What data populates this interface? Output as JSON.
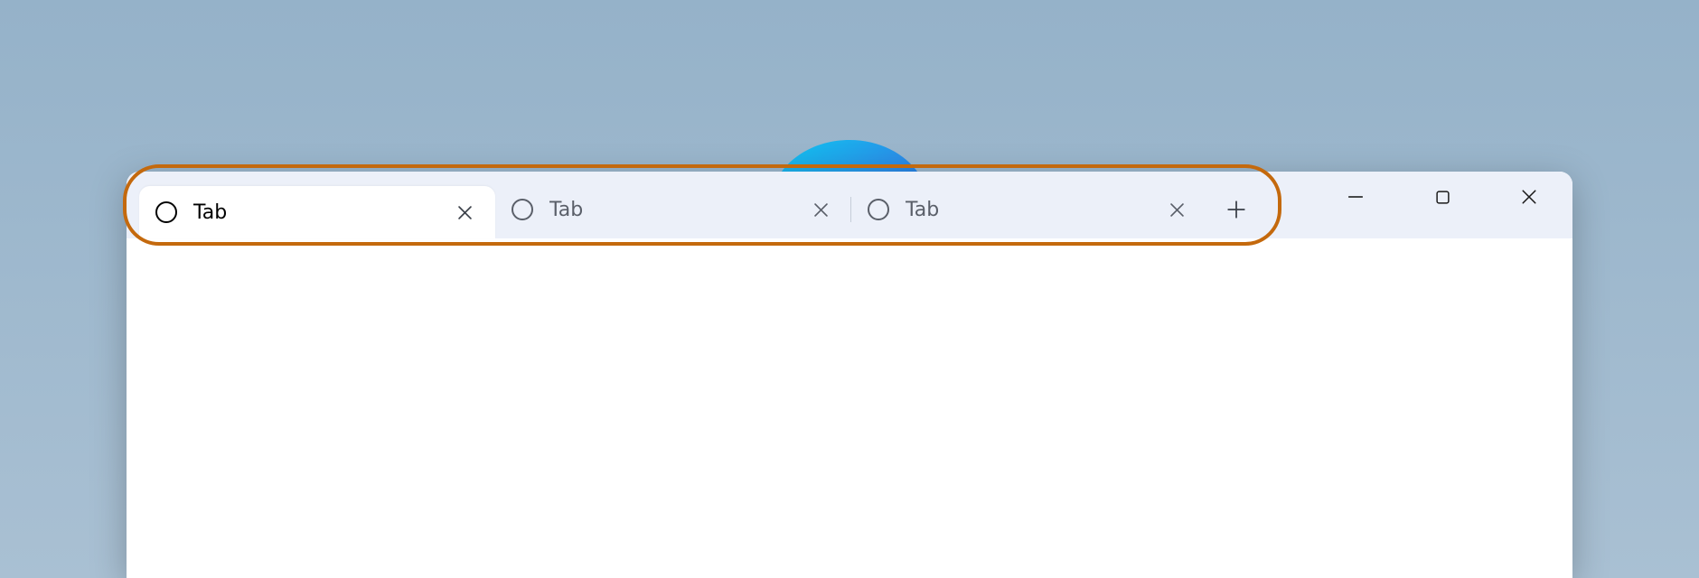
{
  "tabs": [
    {
      "label": "Tab",
      "active": true
    },
    {
      "label": "Tab",
      "active": false
    },
    {
      "label": "Tab",
      "active": false
    }
  ],
  "highlight": {
    "target": "tab-strip"
  }
}
